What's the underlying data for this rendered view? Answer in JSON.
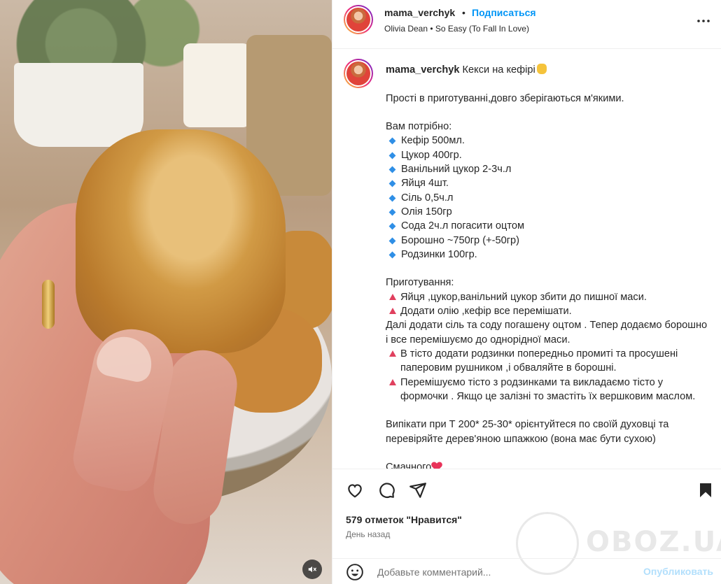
{
  "header": {
    "username": "mama_verchyk",
    "separator": "•",
    "follow_label": "Подписаться",
    "audio": "Olivia Dean • So Easy (To Fall In Love)",
    "more_icon": "more-horizontal-icon"
  },
  "caption": {
    "username": "mama_verchyk",
    "title": "Кекси на кефірі",
    "intro": "Прості в приготуванні,довго зберігаються м'якими.",
    "need_heading": "Вам потрібно:",
    "ingredients": [
      "Кефір 500мл.",
      "Цукор 400гр.",
      "Ванільний цукор 2-3ч.л",
      "Яйця 4шт.",
      "Сіль 0,5ч.л",
      "Олія 150гр",
      "Сода 2ч.л погасити оцтом",
      "Борошно ~750гр (+-50гр)",
      "Родзинки 100гр."
    ],
    "prep_heading": "Приготування:",
    "step1": "Яйця ,цукор,ванільний цукор збити до пишної маси.",
    "step2": "Додати олію ,кефір все перемішати.",
    "step2_cont": "Далі додати сіль та соду погашену оцтом . Тепер додаємо борошно і все перемішуємо до однорідної маси.",
    "step3": "В тісто додати родзинки попередньо промиті та просушені паперовим рушником ,і обваляйте в борошні.",
    "step4": "Перемішуємо тісто з родзинками та викладаємо тісто у формочки . Якщо це залізні то змастіть їх вершковим маслом.",
    "bake": "Випікати при Т 200* 25-30* орієнтуйтеся по своїй духовці та перевіряйте дерев'яною шпажкою (вона має бути сухою)",
    "closing": "Смачного"
  },
  "actions": {
    "like_icon": "heart-icon",
    "comment_icon": "comment-icon",
    "share_icon": "share-icon",
    "save_icon": "bookmark-icon"
  },
  "stats": {
    "likes": "579 отметок \"Нравится\"",
    "date": "День назад"
  },
  "comment_bar": {
    "placeholder": "Добавьте комментарий...",
    "post_label": "Опубликовать"
  },
  "watermark": {
    "text": "OBOZ.UA"
  },
  "colors": {
    "link_blue": "#0095f6",
    "post_disabled": "#b2dffc",
    "text": "#262626",
    "muted": "#737373"
  }
}
